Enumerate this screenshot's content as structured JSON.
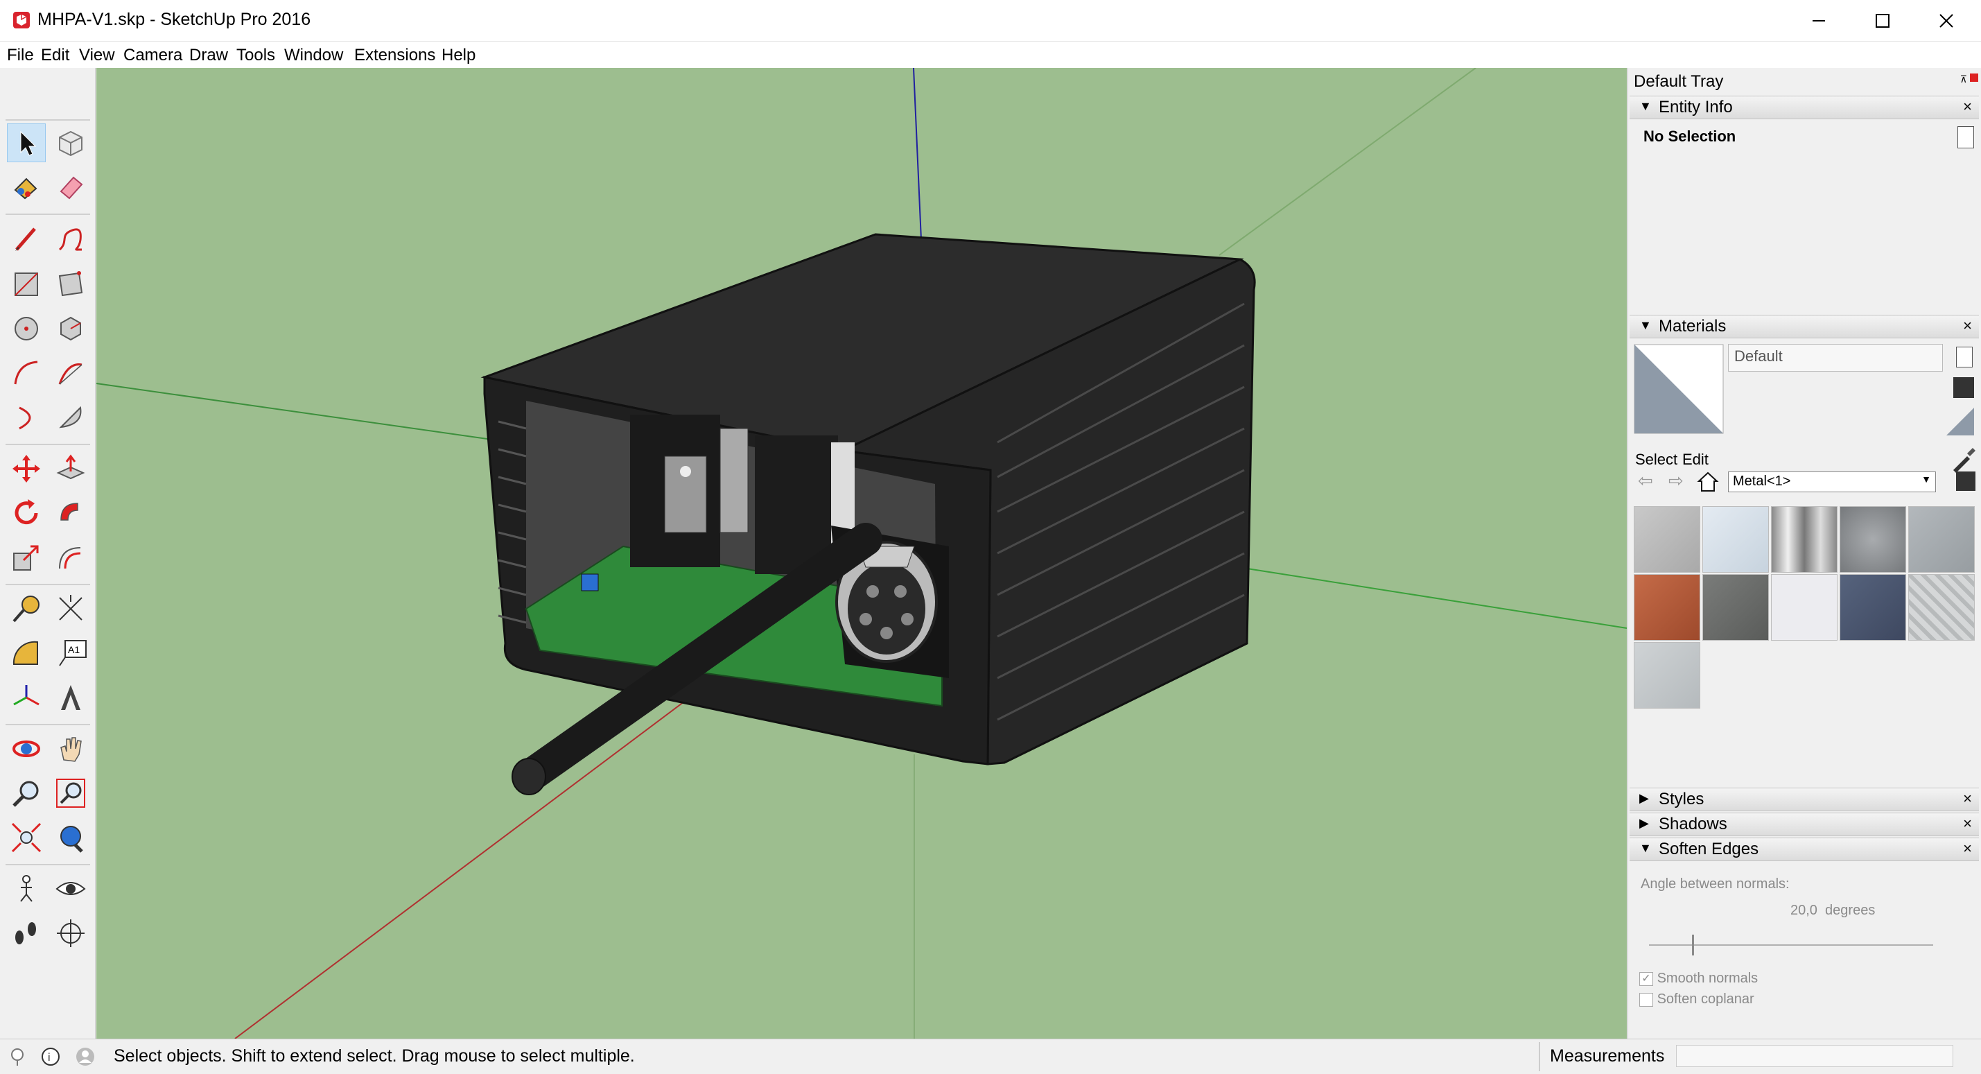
{
  "window": {
    "title": "MHPA-V1.skp - SketchUp Pro 2016",
    "minimize_icon": "minimize-icon",
    "maximize_icon": "maximize-icon",
    "close_icon": "close-icon"
  },
  "menu": [
    "File",
    "Edit",
    "View",
    "Camera",
    "Draw",
    "Tools",
    "Window",
    "Extensions",
    "Help"
  ],
  "toolbar": {
    "tools": [
      "select-icon",
      "make-component-icon",
      "paint-bucket-icon",
      "eraser-icon",
      "pencil-line-icon",
      "freehand-icon",
      "rectangle-icon",
      "rotated-rectangle-icon",
      "circle-icon",
      "polygon-icon",
      "arc-icon",
      "two-point-arc-icon",
      "three-point-arc-icon",
      "pie-icon",
      "move-icon",
      "push-pull-icon",
      "rotate-icon",
      "follow-me-icon",
      "scale-icon",
      "offset-icon",
      "tape-measure-icon",
      "dimension-icon",
      "protractor-icon",
      "text-icon",
      "axes-icon",
      "3d-text-icon",
      "orbit-icon",
      "pan-icon",
      "zoom-icon",
      "zoom-window-icon",
      "zoom-extents-icon",
      "previous-view-icon",
      "position-camera-icon",
      "look-around-icon",
      "walk-icon",
      "section-plane-icon"
    ],
    "text_tool_label": "A1"
  },
  "tray": {
    "title": "Default Tray",
    "entity_info": {
      "title": "Entity Info",
      "selection": "No Selection"
    },
    "materials": {
      "title": "Materials",
      "current": "Default",
      "tab_select": "Select",
      "tab_edit": "Edit",
      "library": "Metal<1>",
      "swatch_colors": [
        "#bdbdbd",
        "#d8e0e8",
        "#c8c8c8",
        "#8c8f92",
        "#a4aaae",
        "#b96040",
        "#6d6f6d",
        "#ececf0",
        "#4e5a72",
        "#c9cbcc",
        "#c3c8ca"
      ]
    },
    "styles": {
      "title": "Styles"
    },
    "shadows": {
      "title": "Shadows"
    },
    "soften_edges": {
      "title": "Soften Edges",
      "angle_label": "Angle between normals:",
      "angle_value": "20,0  degrees",
      "slider_fraction": 0.15,
      "smooth_normals": "Smooth normals",
      "smooth_normals_checked": true,
      "soften_coplanar": "Soften coplanar",
      "soften_coplanar_checked": false
    }
  },
  "status": {
    "hint": "Select objects. Shift to extend select. Drag mouse to select multiple.",
    "measurements_label": "Measurements",
    "measurements_value": ""
  },
  "colors": {
    "viewport_bg": "#9dbe8f",
    "enclosure": "#2f2f2f",
    "pcb": "#2f8a3a",
    "axis_red": "#c03030",
    "axis_green": "#2a9a2a",
    "axis_blue": "#2020a0"
  }
}
